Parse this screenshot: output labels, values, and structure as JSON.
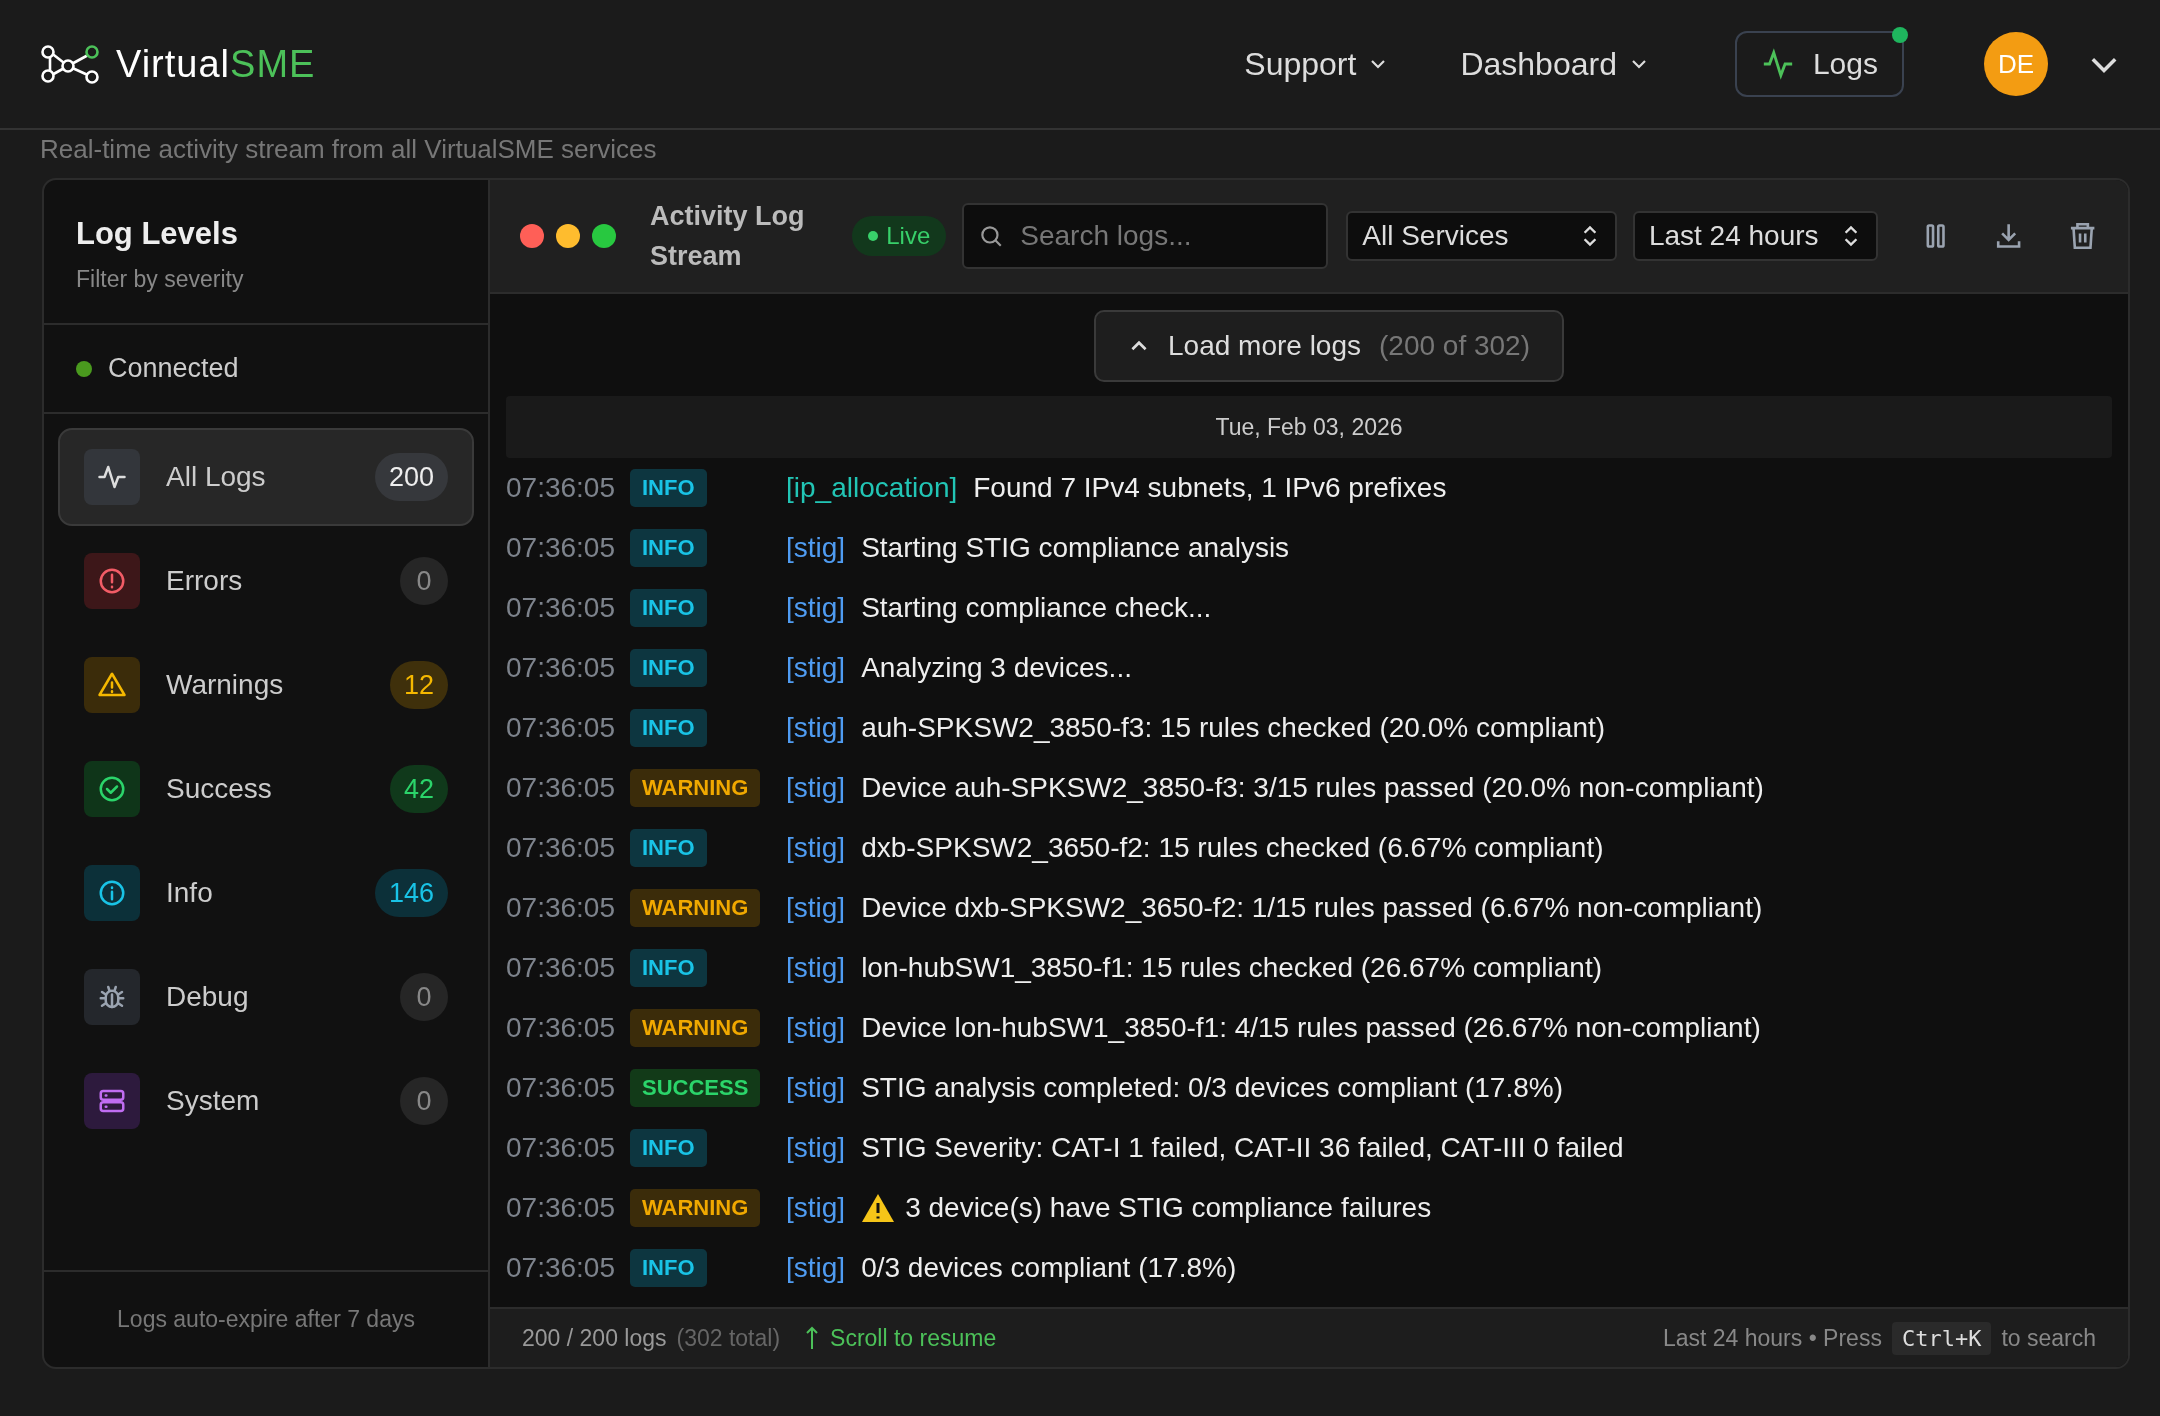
{
  "brand": {
    "name_part1": "Virtual",
    "name_part2": "SME"
  },
  "nav": [
    {
      "label": "Support"
    },
    {
      "label": "Dashboard"
    }
  ],
  "logs_button": {
    "label": "Logs",
    "notification": true
  },
  "avatar": {
    "initials": "DE"
  },
  "subtitle": "Real-time activity stream from all VirtualSME services",
  "sidebar": {
    "title": "Log Levels",
    "subtitle": "Filter by severity",
    "connection": "Connected",
    "footer": "Logs auto-expire after 7 days",
    "items": [
      {
        "kind": "all",
        "label": "All Logs",
        "count": "200",
        "selected": true
      },
      {
        "kind": "error",
        "label": "Errors",
        "count": "0",
        "selected": false
      },
      {
        "kind": "warning",
        "label": "Warnings",
        "count": "12",
        "selected": false
      },
      {
        "kind": "success",
        "label": "Success",
        "count": "42",
        "selected": false
      },
      {
        "kind": "info",
        "label": "Info",
        "count": "146",
        "selected": false
      },
      {
        "kind": "debug",
        "label": "Debug",
        "count": "0",
        "selected": false
      },
      {
        "kind": "system",
        "label": "System",
        "count": "0",
        "selected": false
      }
    ]
  },
  "panel": {
    "title": "Activity Log Stream",
    "live": "Live",
    "search": {
      "placeholder": "Search logs..."
    },
    "service_select": "All Services",
    "range_select": "Last 24 hours",
    "load_more": {
      "label": "Load more logs",
      "count": "(200 of 302)"
    },
    "date": "Tue, Feb 03, 2026",
    "entries": [
      {
        "time": "07:36:05",
        "kind": "info",
        "level": "INFO",
        "source": "[ip_allocation]",
        "color": "#22c5b5",
        "message": "Found 7 IPv4 subnets, 1 IPv6 prefixes"
      },
      {
        "time": "07:36:05",
        "kind": "info",
        "level": "INFO",
        "source": "[stig]",
        "color": "#4f9cf2",
        "message": "Starting STIG compliance analysis"
      },
      {
        "time": "07:36:05",
        "kind": "info",
        "level": "INFO",
        "source": "[stig]",
        "color": "#4f9cf2",
        "message": "Starting compliance check..."
      },
      {
        "time": "07:36:05",
        "kind": "info",
        "level": "INFO",
        "source": "[stig]",
        "color": "#4f9cf2",
        "message": "Analyzing 3 devices..."
      },
      {
        "time": "07:36:05",
        "kind": "info",
        "level": "INFO",
        "source": "[stig]",
        "color": "#4f9cf2",
        "message": "auh-SPKSW2_3850-f3: 15 rules checked (20.0% compliant)"
      },
      {
        "time": "07:36:05",
        "kind": "warning",
        "level": "WARNING",
        "source": "[stig]",
        "color": "#4f9cf2",
        "message": "Device auh-SPKSW2_3850-f3: 3/15 rules passed (20.0% non-compliant)"
      },
      {
        "time": "07:36:05",
        "kind": "info",
        "level": "INFO",
        "source": "[stig]",
        "color": "#4f9cf2",
        "message": "dxb-SPKSW2_3650-f2: 15 rules checked (6.67% compliant)"
      },
      {
        "time": "07:36:05",
        "kind": "warning",
        "level": "WARNING",
        "source": "[stig]",
        "color": "#4f9cf2",
        "message": "Device dxb-SPKSW2_3650-f2: 1/15 rules passed (6.67% non-compliant)"
      },
      {
        "time": "07:36:05",
        "kind": "info",
        "level": "INFO",
        "source": "[stig]",
        "color": "#4f9cf2",
        "message": "lon-hubSW1_3850-f1: 15 rules checked (26.67% compliant)"
      },
      {
        "time": "07:36:05",
        "kind": "warning",
        "level": "WARNING",
        "source": "[stig]",
        "color": "#4f9cf2",
        "message": "Device lon-hubSW1_3850-f1: 4/15 rules passed (26.67% non-compliant)"
      },
      {
        "time": "07:36:05",
        "kind": "success",
        "level": "SUCCESS",
        "source": "[stig]",
        "color": "#4f9cf2",
        "message": "STIG analysis completed: 0/3 devices compliant (17.8%)"
      },
      {
        "time": "07:36:05",
        "kind": "info",
        "level": "INFO",
        "source": "[stig]",
        "color": "#4f9cf2",
        "message": "STIG Severity: CAT-I 1 failed, CAT-II 36 failed, CAT-III 0 failed"
      },
      {
        "time": "07:36:05",
        "kind": "warning",
        "level": "WARNING",
        "source": "[stig]",
        "color": "#4f9cf2",
        "warning_icon": true,
        "message": "3 device(s) have STIG compliance failures"
      },
      {
        "time": "07:36:05",
        "kind": "info",
        "level": "INFO",
        "source": "[stig]",
        "color": "#4f9cf2",
        "message": "0/3 devices compliant (17.8%)"
      }
    ],
    "footer": {
      "count": "200 / 200 logs",
      "total": "(302 total)",
      "scroll": "Scroll to resume",
      "hint_before": "Last 24 hours • Press",
      "shortcut": "Ctrl+K",
      "hint_after": "to search"
    }
  }
}
